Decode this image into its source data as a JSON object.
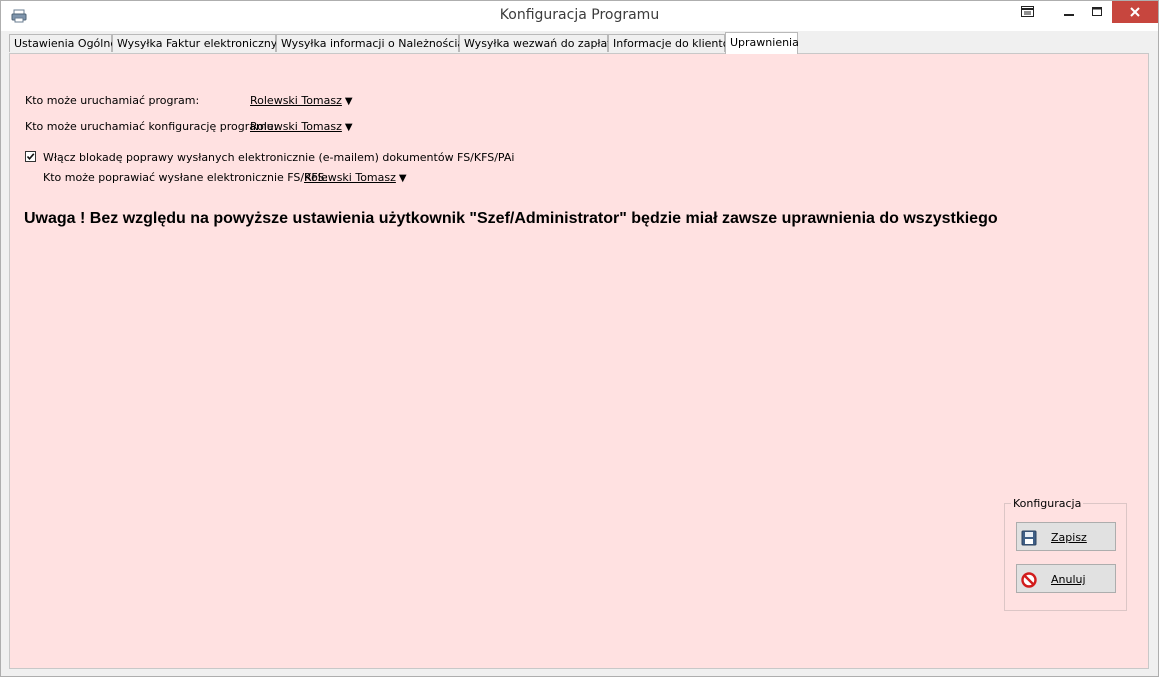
{
  "window": {
    "title": "Konfiguracja Programu",
    "app_icon": "printer-icon",
    "controls": [
      "restore-icon",
      "minimize-icon",
      "maximize-icon",
      "close-icon"
    ]
  },
  "tabs": [
    {
      "label": "Ustawienia Ogólne",
      "active": false
    },
    {
      "label": "Wysyłka Faktur elektronicznych",
      "active": false
    },
    {
      "label": "Wysyłka informacji o Należnościach",
      "active": false
    },
    {
      "label": "Wysyłka wezwań do zapłaty",
      "active": false
    },
    {
      "label": "Informacje do klientów",
      "active": false
    },
    {
      "label": "Uprawnienia",
      "active": true
    }
  ],
  "permissions": {
    "run_program": {
      "label": "Kto może uruchamiać program:",
      "value": "Rolewski Tomasz"
    },
    "run_config": {
      "label": "Kto może uruchamiać konfigurację programu:",
      "value": "Rolewski Tomasz"
    },
    "lock_checkbox": {
      "label": "Włącz blokadę poprawy wysłanych elektronicznie (e-mailem) dokumentów FS/KFS/PAi",
      "checked": true
    },
    "edit_sent": {
      "label": "Kto może poprawiać wysłane elektronicznie FS/KFS:",
      "value": "Rolewski Tomasz"
    },
    "warning": "Uwaga ! Bez względu na powyższe ustawienia użytkownik \"Szef/Administrator\" będzie miał zawsze uprawnienia do wszystkiego"
  },
  "config_group": {
    "title": "Konfiguracja",
    "save_label": "Zapisz",
    "save_icon": "floppy-disk-icon",
    "cancel_label": "Anuluj",
    "cancel_icon": "cancel-icon"
  },
  "colors": {
    "panel_background": "#ffe1e1",
    "close_button": "#c7463e"
  }
}
